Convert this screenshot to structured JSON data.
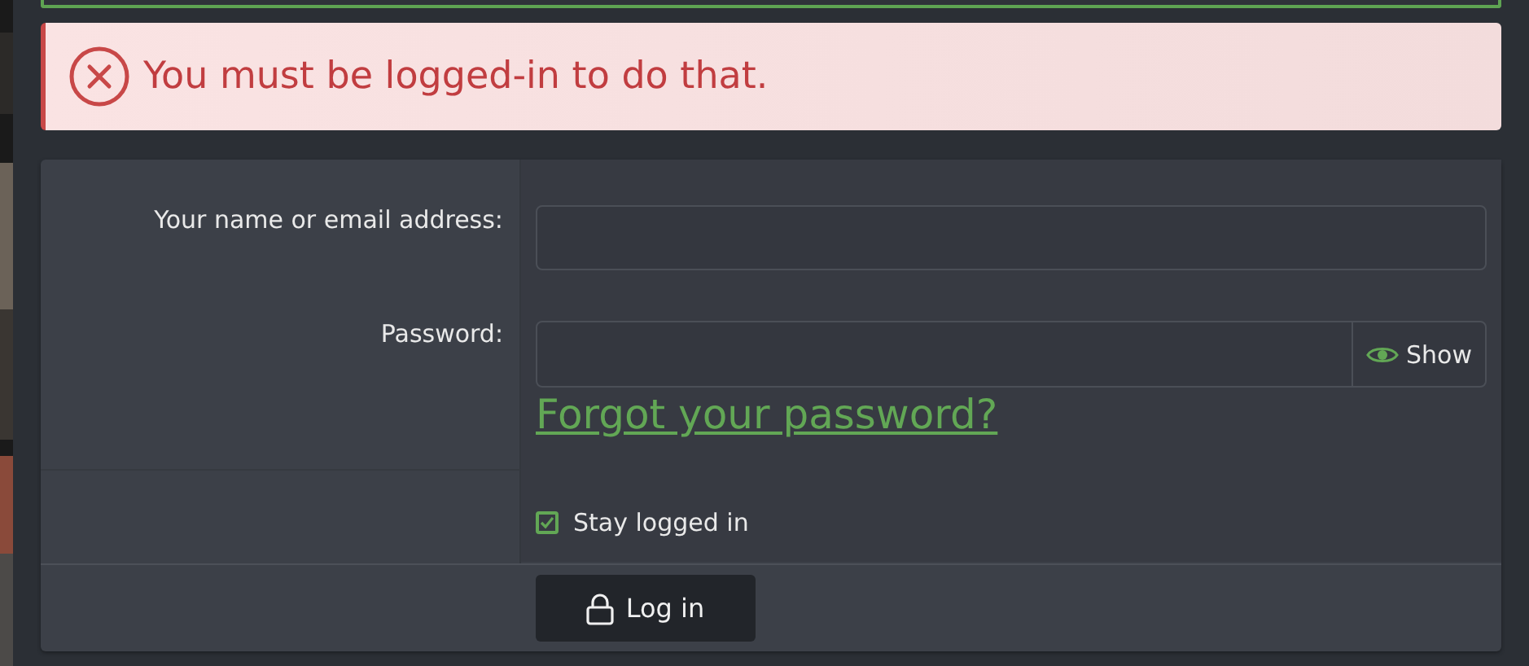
{
  "error": {
    "message": "You must be logged-in to do that."
  },
  "form": {
    "username": {
      "label": "Your name or email address:"
    },
    "password": {
      "label": "Password:",
      "toggle": "Show",
      "forgot_link": "Forgot your password?"
    },
    "stay_logged_in": {
      "label": "Stay logged in",
      "checked": true
    },
    "submit": "Log in"
  }
}
